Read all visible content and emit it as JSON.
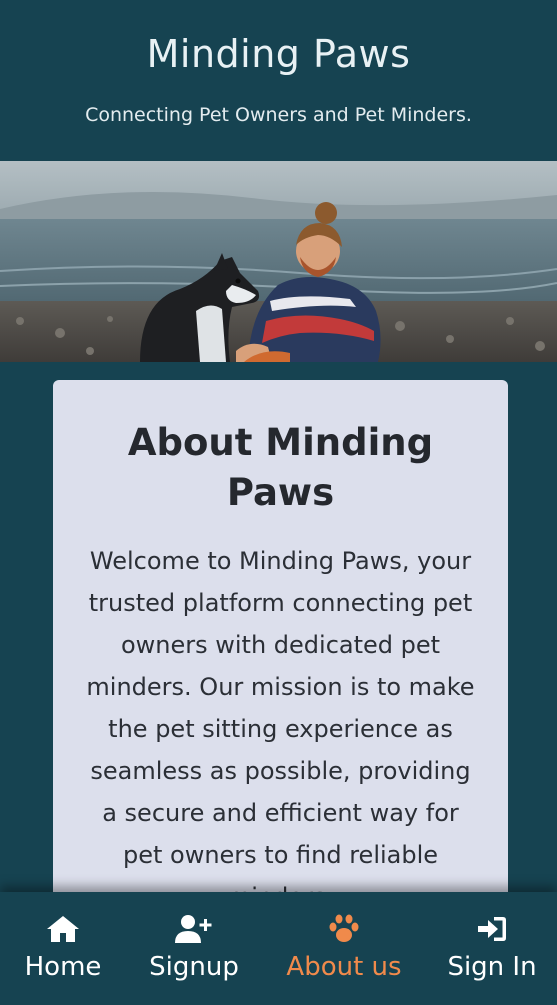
{
  "header": {
    "title": "Minding Paws",
    "tagline": "Connecting Pet Owners and Pet Minders."
  },
  "hero": {
    "image_description_icon": "hero-photo"
  },
  "about": {
    "title": "About Minding Paws",
    "text": "Welcome to Minding Paws, your trusted platform connecting pet owners with dedicated pet minders. Our mission is to make the pet sitting experience as seamless as possible, providing a secure and efficient way for pet owners to find reliable minders."
  },
  "nav": {
    "items": [
      {
        "label": "Home",
        "icon": "home-icon",
        "active": false
      },
      {
        "label": "Signup",
        "icon": "user-plus-icon",
        "active": false
      },
      {
        "label": "About us",
        "icon": "paw-icon",
        "active": true
      },
      {
        "label": "Sign In",
        "icon": "sign-in-icon",
        "active": false
      }
    ]
  },
  "colors": {
    "background": "#164351",
    "card": "#dcdfec",
    "accent": "#f08a4b",
    "nav_text": "#ffffff"
  }
}
